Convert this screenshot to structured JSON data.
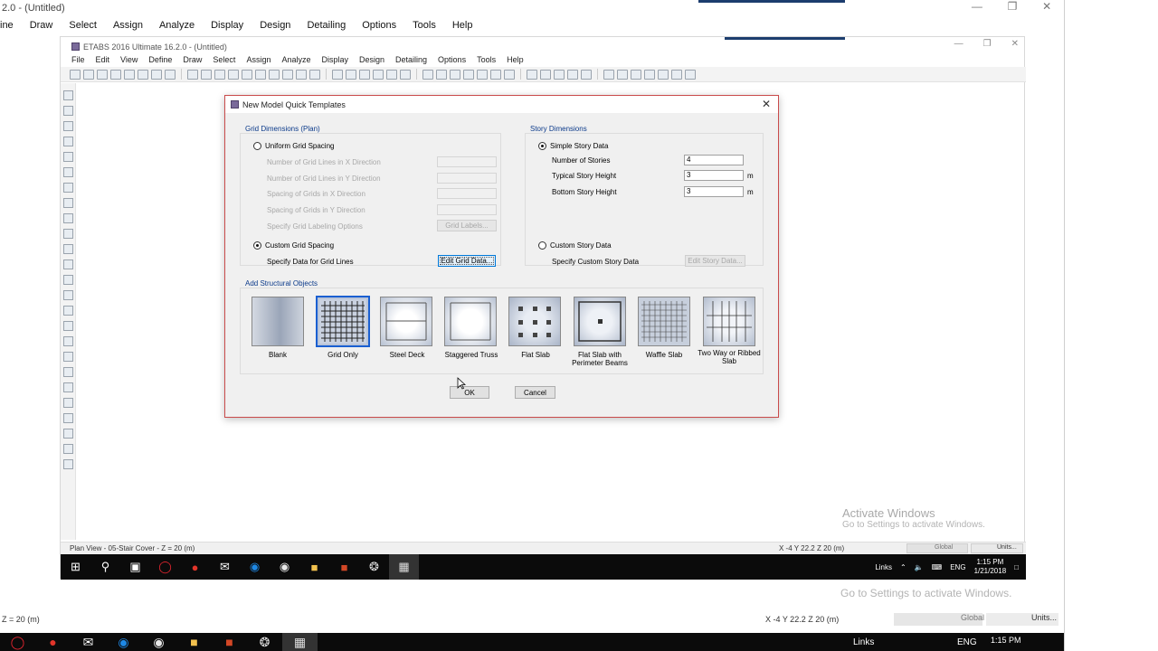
{
  "outer_window": {
    "title": "2.0 - (Untitled)",
    "menu": [
      "ine",
      "Draw",
      "Select",
      "Assign",
      "Analyze",
      "Display",
      "Design",
      "Detailing",
      "Options",
      "Tools",
      "Help"
    ],
    "status_left": "Z = 20 (m)",
    "status_coords": "X -4  Y 22.2  Z 20 (m)",
    "status_global": "Global",
    "status_units": "Units..."
  },
  "inner_window": {
    "title": "ETABS 2016 Ultimate 16.2.0 - (Untitled)",
    "menu": [
      "File",
      "Edit",
      "View",
      "Define",
      "Draw",
      "Select",
      "Assign",
      "Analyze",
      "Display",
      "Design",
      "Detailing",
      "Options",
      "Tools",
      "Help"
    ],
    "status_left": "Plan View - 05-Stair Cover - Z = 20 (m)",
    "status_coords": "X -4  Y 22.2  Z 20 (m)",
    "status_global": "Global",
    "status_units": "Units..."
  },
  "watermark": {
    "title": "Activate Windows",
    "subtitle": "Go to Settings to activate Windows."
  },
  "taskbar": {
    "tray_links": "Links",
    "tray_lang": "ENG",
    "time": "1:15 PM",
    "date": "1/21/2018"
  },
  "dialog": {
    "title": "New Model Quick Templates",
    "grid_section": {
      "label": "Grid Dimensions (Plan)",
      "uniform_label": "Uniform Grid Spacing",
      "num_x_label": "Number of Grid Lines in X Direction",
      "num_y_label": "Number of Grid Lines in Y Direction",
      "spacing_x_label": "Spacing of Grids in X Direction",
      "spacing_y_label": "Spacing of Grids in Y Direction",
      "labeling_label": "Specify Grid Labeling Options",
      "grid_labels_button": "Grid Labels...",
      "custom_label": "Custom Grid Spacing",
      "specify_label": "Specify Data for Grid Lines",
      "edit_grid_button": "Edit Grid Data..."
    },
    "story_section": {
      "label": "Story Dimensions",
      "simple_label": "Simple Story Data",
      "num_stories_label": "Number of Stories",
      "num_stories_value": "4",
      "typical_height_label": "Typical Story Height",
      "typical_height_value": "3",
      "bottom_height_label": "Bottom Story Height",
      "bottom_height_value": "3",
      "unit": "m",
      "custom_label": "Custom Story Data",
      "specify_label": "Specify Custom Story Data",
      "edit_story_button": "Edit Story Data..."
    },
    "objects_section": {
      "label": "Add Structural Objects",
      "templates": [
        {
          "label": "Blank"
        },
        {
          "label": "Grid Only"
        },
        {
          "label": "Steel Deck"
        },
        {
          "label": "Staggered Truss"
        },
        {
          "label": "Flat Slab"
        },
        {
          "label": "Flat Slab with Perimeter Beams"
        },
        {
          "label": "Waffle Slab"
        },
        {
          "label": "Two Way or Ribbed Slab"
        }
      ]
    },
    "ok_button": "OK",
    "cancel_button": "Cancel"
  }
}
